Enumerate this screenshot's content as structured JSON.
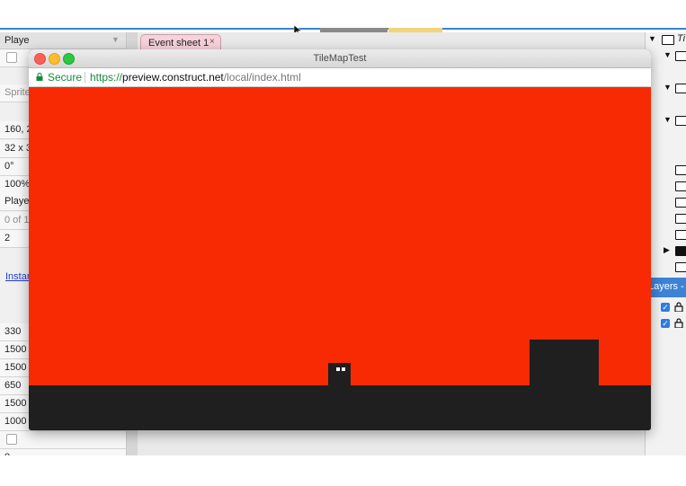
{
  "editor": {
    "left_panel": {
      "header": "Playe",
      "rows": [
        {
          "text": "",
          "checkbox": true
        },
        {
          "text": "Sprite",
          "gray": true
        },
        {
          "text": ""
        },
        {
          "text": "160, 2"
        },
        {
          "text": "32 x 3"
        },
        {
          "text": "0°"
        },
        {
          "text": "100%"
        },
        {
          "text": "Playe"
        },
        {
          "text": "0 of 1",
          "gray": true
        },
        {
          "text": "2"
        }
      ],
      "link": "Instan",
      "rows2": [
        {
          "text": "330"
        },
        {
          "text": "1500"
        },
        {
          "text": "1500"
        },
        {
          "text": "650"
        },
        {
          "text": "1500"
        },
        {
          "text": "1000"
        },
        {
          "text": "",
          "checkbox": true
        },
        {
          "text": "0"
        }
      ]
    },
    "tab": {
      "label": "Event sheet 1",
      "close": "×"
    },
    "right_panel": {
      "root_label": "Ti",
      "layers_label": "Layers - "
    }
  },
  "browser": {
    "title": "TileMapTest",
    "secure_label": "Secure",
    "url_scheme": "https://",
    "url_host": "preview.construct.net",
    "url_path": "/local/index.html"
  },
  "colors": {
    "sky": "#f72a03",
    "ground": "#1f1f1f",
    "accent": "#3c83d6",
    "secure_green": "#168a3a"
  }
}
